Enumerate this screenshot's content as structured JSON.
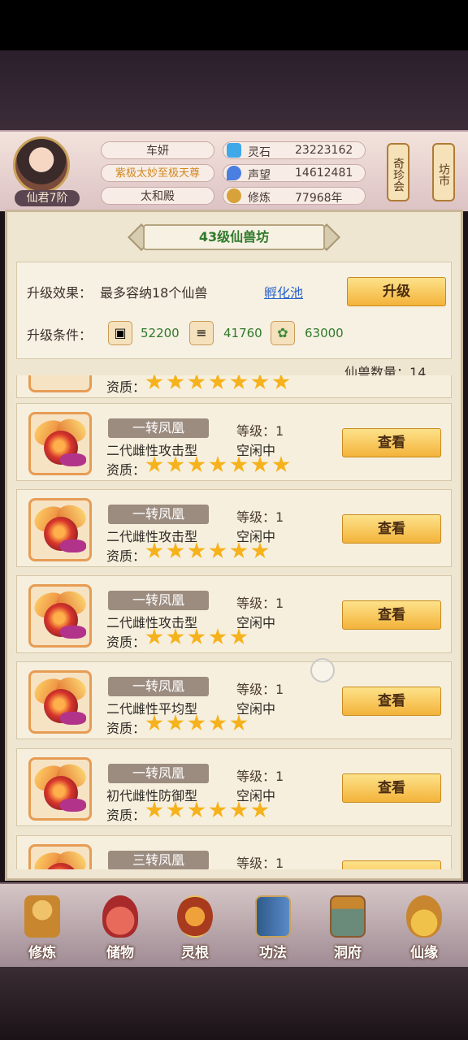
{
  "player": {
    "rank": "仙君7阶",
    "name": "车妍",
    "title": "紫极太妙至极天尊",
    "palace": "太和殿"
  },
  "resources": [
    {
      "label": "灵石",
      "value": "23223162",
      "icon": "gem-icon",
      "color": "#3fa8e8"
    },
    {
      "label": "声望",
      "value": "14612481",
      "icon": "drop-icon",
      "color": "#4a7ee0"
    },
    {
      "label": "修炼",
      "value": "77968年",
      "icon": "meditation-icon",
      "color": "#d8a23a"
    }
  ],
  "side_buttons": {
    "treasure": "奇珍会",
    "market": "坊市"
  },
  "panel": {
    "title": "43级仙兽坊",
    "effect_label": "升级效果：",
    "effect_text": "最多容纳18个仙兽",
    "hatch_link": "孵化池",
    "upgrade_button": "升级",
    "conditions_label": "升级条件：",
    "materials": [
      {
        "icon": "ore-icon",
        "value": "52200"
      },
      {
        "icon": "wood-icon",
        "value": "41760"
      },
      {
        "icon": "herb-icon",
        "value": "63000"
      }
    ],
    "count_label": "仙兽数量：",
    "count_value": "14"
  },
  "beasts": [
    {
      "name": "",
      "level_label": "",
      "type": "",
      "status": "",
      "quality_label": "资质：",
      "stars": 7,
      "view": ""
    },
    {
      "name": "一转凤凰",
      "level_label": "等级：1",
      "type": "二代雌性攻击型",
      "status": "空闲中",
      "quality_label": "资质：",
      "stars": 7,
      "view": "查看"
    },
    {
      "name": "一转凤凰",
      "level_label": "等级：1",
      "type": "二代雌性攻击型",
      "status": "空闲中",
      "quality_label": "资质：",
      "stars": 6,
      "view": "查看"
    },
    {
      "name": "一转凤凰",
      "level_label": "等级：1",
      "type": "二代雌性攻击型",
      "status": "空闲中",
      "quality_label": "资质：",
      "stars": 5,
      "view": "查看"
    },
    {
      "name": "一转凤凰",
      "level_label": "等级：1",
      "type": "二代雌性平均型",
      "status": "空闲中",
      "quality_label": "资质：",
      "stars": 5,
      "view": "查看"
    },
    {
      "name": "一转凤凰",
      "level_label": "等级：1",
      "type": "初代雌性防御型",
      "status": "空闲中",
      "quality_label": "资质：",
      "stars": 6,
      "view": "查看"
    },
    {
      "name": "三转凤凰",
      "level_label": "等级：1",
      "type": "",
      "status": "",
      "quality_label": "",
      "stars": 0,
      "view": ""
    }
  ],
  "nav": [
    {
      "label": "修炼",
      "icon": "monk-icon",
      "color": "#c8862e"
    },
    {
      "label": "储物",
      "icon": "bag-icon",
      "color": "#c84a3a"
    },
    {
      "label": "灵根",
      "icon": "taiji-icon",
      "color": "#a83a1e"
    },
    {
      "label": "功法",
      "icon": "book-icon",
      "color": "#3a6ea8"
    },
    {
      "label": "洞府",
      "icon": "palace-icon",
      "color": "#8a5a2e"
    },
    {
      "label": "仙缘",
      "icon": "gourd-icon",
      "color": "#d89a2a"
    }
  ]
}
